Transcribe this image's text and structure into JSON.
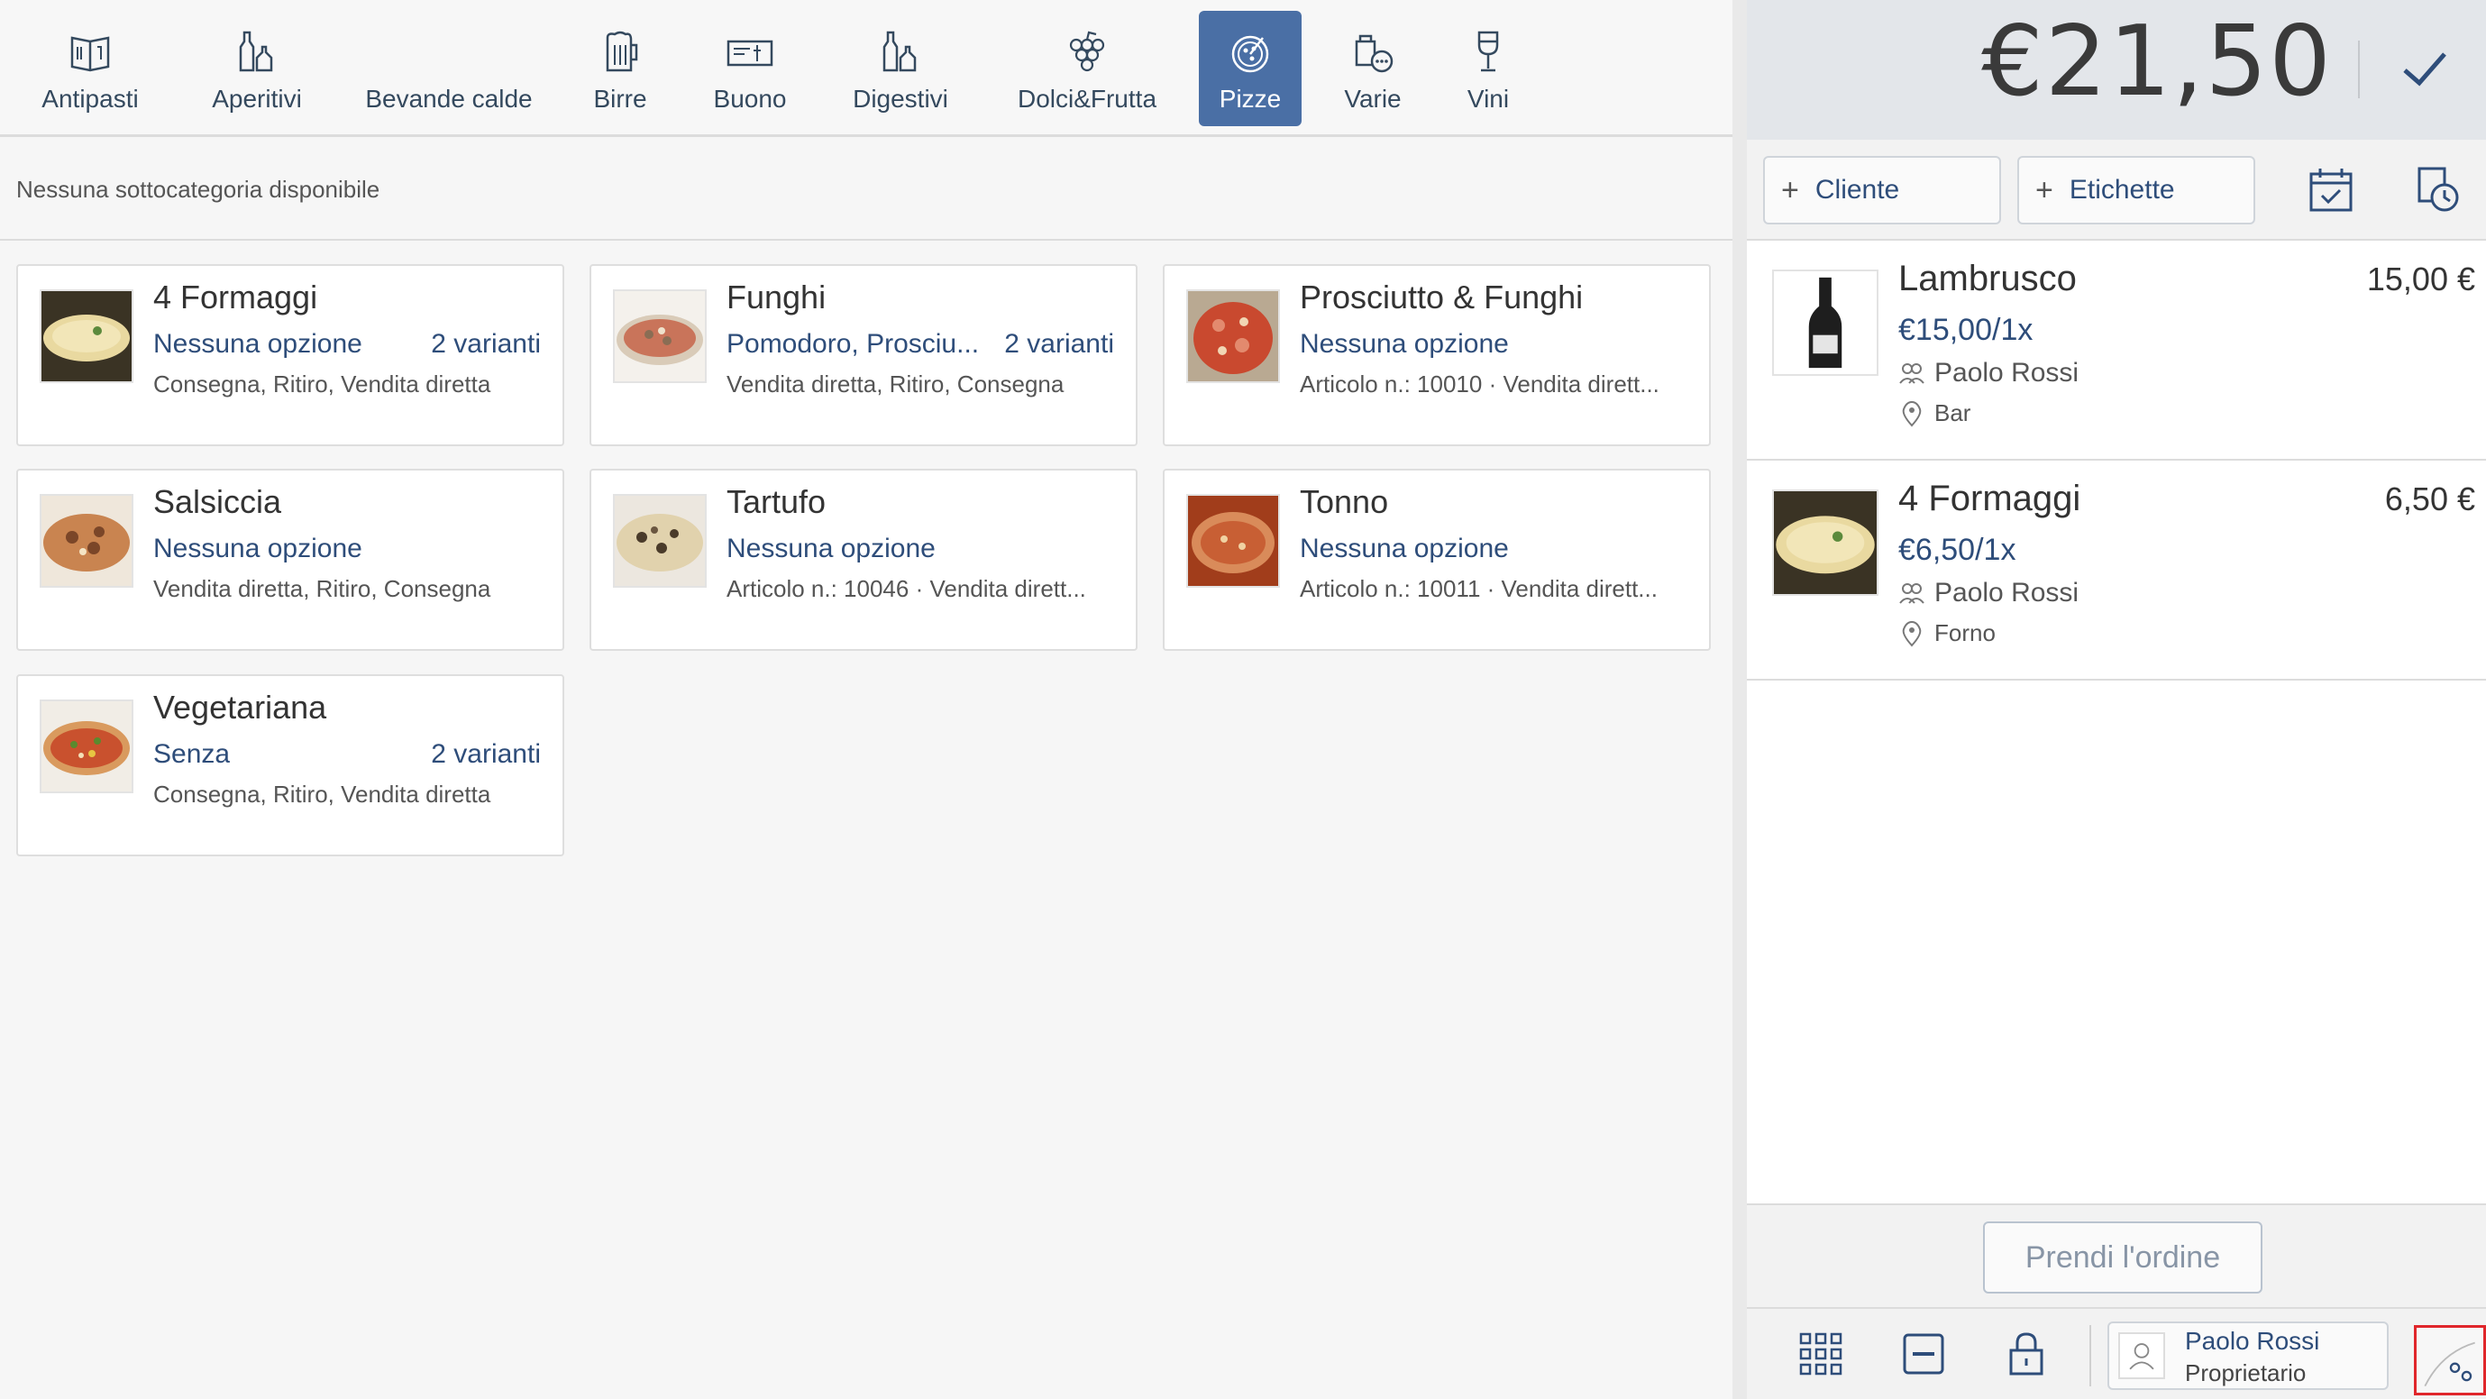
{
  "categories": [
    {
      "label": "Antipasti",
      "icon": "menu-book-icon"
    },
    {
      "label": "Aperitivi",
      "icon": "bottles-icon"
    },
    {
      "label": "Bevande calde",
      "icon": ""
    },
    {
      "label": "Birre",
      "icon": "beer-mug-icon"
    },
    {
      "label": "Buono",
      "icon": "voucher-icon"
    },
    {
      "label": "Digestivi",
      "icon": "bottles-icon"
    },
    {
      "label": "Dolci&Frutta",
      "icon": "grapes-icon"
    },
    {
      "label": "Pizze",
      "icon": "pizza-icon",
      "active": true
    },
    {
      "label": "Varie",
      "icon": "misc-icon"
    },
    {
      "label": "Vini",
      "icon": "wine-glass-icon"
    }
  ],
  "subcategory": {
    "empty_text": "Nessuna sottocategoria disponibile"
  },
  "products": [
    {
      "name": "4 Formaggi",
      "options": "Nessuna opzione",
      "variants": "2 varianti",
      "meta": "Consegna, Ritiro, Vendita diretta"
    },
    {
      "name": "Funghi",
      "options": "Pomodoro, Prosciu...",
      "variants": "2 varianti",
      "meta": "Vendita diretta, Ritiro, Consegna"
    },
    {
      "name": "Prosciutto & Funghi",
      "options": "Nessuna opzione",
      "variants": "",
      "meta": "Articolo n.: 10010 · Vendita dirett..."
    },
    {
      "name": "Salsiccia",
      "options": "Nessuna opzione",
      "variants": "",
      "meta": "Vendita diretta, Ritiro, Consegna"
    },
    {
      "name": "Tartufo",
      "options": "Nessuna opzione",
      "variants": "",
      "meta": "Articolo n.: 10046 · Vendita dirett..."
    },
    {
      "name": "Tonno",
      "options": "Nessuna opzione",
      "variants": "",
      "meta": "Articolo n.: 10011 · Vendita dirett..."
    },
    {
      "name": "Vegetariana",
      "options": "Senza",
      "variants": "2 varianti",
      "meta": "Consegna, Ritiro, Vendita diretta"
    }
  ],
  "cart": {
    "total": "€21,50",
    "customer_label": "Cliente",
    "labels_label": "Etichette",
    "items": [
      {
        "name": "Lambrusco",
        "price": "15,00 €",
        "unit": "€15,00/1x",
        "user": "Paolo Rossi",
        "station": "Bar"
      },
      {
        "name": "4 Formaggi",
        "price": "6,50 €",
        "unit": "€6,50/1x",
        "user": "Paolo Rossi",
        "station": "Forno"
      }
    ],
    "take_order_label": "Prendi l'ordine"
  },
  "user": {
    "name": "Paolo Rossi",
    "role": "Proprietario"
  },
  "colors": {
    "accent": "#4a6fa5",
    "link": "#2e4d7a",
    "highlight": "#e0262b"
  }
}
